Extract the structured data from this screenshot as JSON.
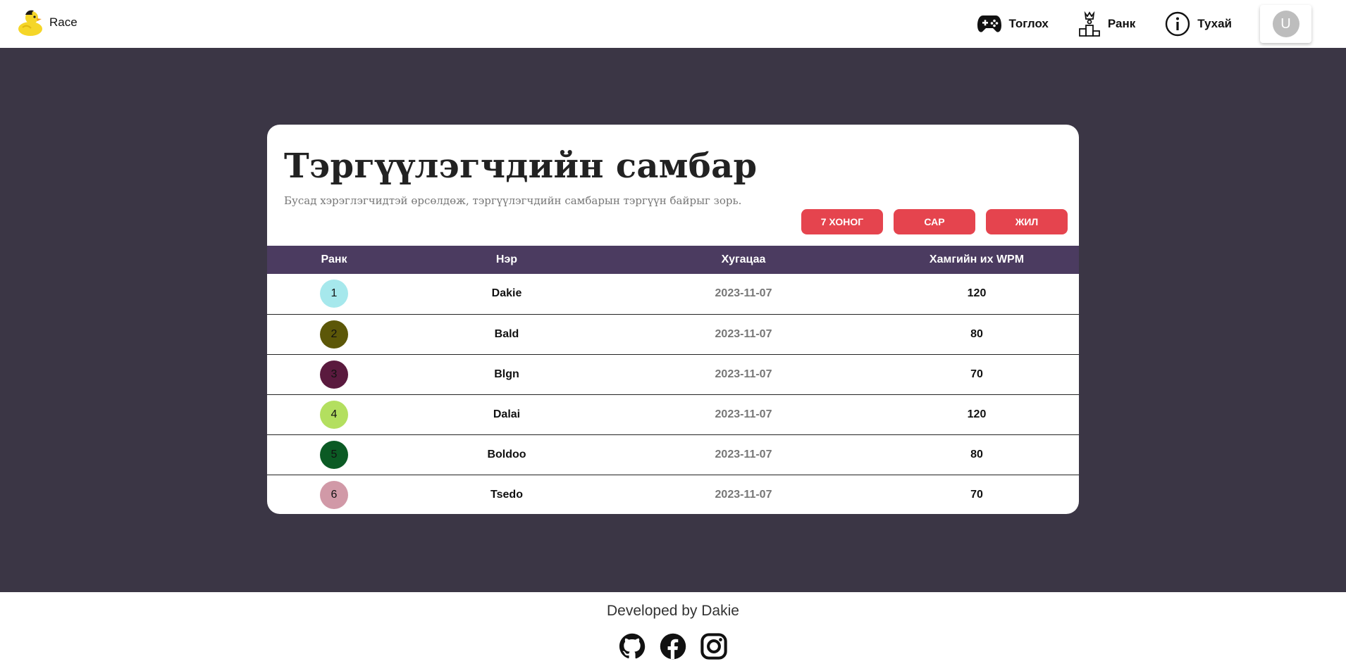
{
  "header": {
    "brand": "Race",
    "nav": [
      {
        "label": "Тоглох",
        "icon": "gamepad-icon"
      },
      {
        "label": "Ранк",
        "icon": "podium-icon"
      },
      {
        "label": "Тухай",
        "icon": "info-icon"
      }
    ],
    "avatar_letter": "U"
  },
  "leaderboard": {
    "title": "Тэргүүлэгчдийн самбар",
    "subtitle": "Бусад хэрэглэгчидтэй өрсөлдөж, тэргүүлэгчдийн самбарын тэргүүн байрыг зорь.",
    "filters": [
      "7 ХОНОГ",
      "САР",
      "ЖИЛ"
    ],
    "columns": [
      "Ранк",
      "Нэр",
      "Хугацаа",
      "Хамгийн их WPM"
    ],
    "rows": [
      {
        "rank": "1",
        "name": "Dakie",
        "date": "2023-11-07",
        "wpm": "120",
        "color": "#a6e8ec"
      },
      {
        "rank": "2",
        "name": "Bald",
        "date": "2023-11-07",
        "wpm": "80",
        "color": "#5c5708"
      },
      {
        "rank": "3",
        "name": "Blgn",
        "date": "2023-11-07",
        "wpm": "70",
        "color": "#5a1a3e"
      },
      {
        "rank": "4",
        "name": "Dalai",
        "date": "2023-11-07",
        "wpm": "120",
        "color": "#b3df5f"
      },
      {
        "rank": "5",
        "name": "Boldoo",
        "date": "2023-11-07",
        "wpm": "80",
        "color": "#0b5a24"
      },
      {
        "rank": "6",
        "name": "Tsedo",
        "date": "2023-11-07",
        "wpm": "70",
        "color": "#d199a7"
      }
    ]
  },
  "footer": {
    "text": "Developed by Dakie",
    "socials": [
      "github-icon",
      "facebook-icon",
      "instagram-icon"
    ]
  },
  "colors": {
    "background": "#3b3645",
    "table_header": "#4b3b60",
    "accent": "#e5444e"
  }
}
